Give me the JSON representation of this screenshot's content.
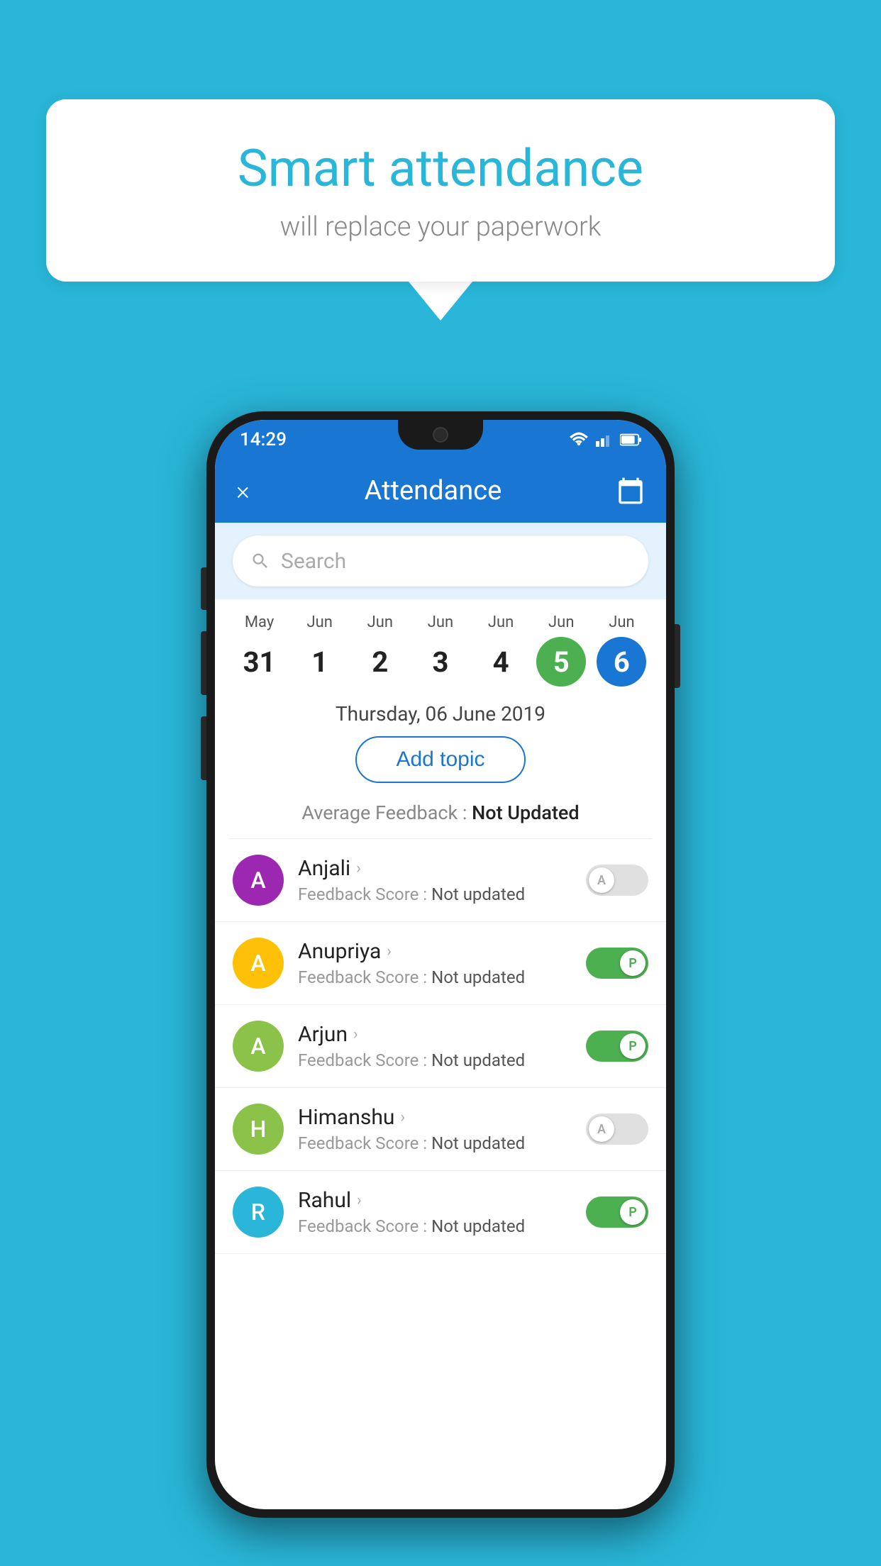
{
  "background_color": "#29b6d8",
  "speech_bubble": {
    "title": "Smart attendance",
    "subtitle": "will replace your paperwork"
  },
  "status_bar": {
    "time": "14:29",
    "wifi_icon": "wifi",
    "signal_icon": "signal",
    "battery_icon": "battery"
  },
  "header": {
    "title": "Attendance",
    "close_label": "×",
    "calendar_icon": "calendar"
  },
  "search": {
    "placeholder": "Search"
  },
  "calendar": {
    "days": [
      {
        "month": "May",
        "date": "31",
        "state": "normal"
      },
      {
        "month": "Jun",
        "date": "1",
        "state": "normal"
      },
      {
        "month": "Jun",
        "date": "2",
        "state": "normal"
      },
      {
        "month": "Jun",
        "date": "3",
        "state": "normal"
      },
      {
        "month": "Jun",
        "date": "4",
        "state": "normal"
      },
      {
        "month": "Jun",
        "date": "5",
        "state": "today"
      },
      {
        "month": "Jun",
        "date": "6",
        "state": "selected"
      }
    ]
  },
  "selected_date_label": "Thursday, 06 June 2019",
  "add_topic_label": "Add topic",
  "average_feedback": {
    "label": "Average Feedback : ",
    "value": "Not Updated"
  },
  "students": [
    {
      "name": "Anjali",
      "avatar_letter": "A",
      "avatar_color": "#9c27b0",
      "feedback_label": "Feedback Score : ",
      "feedback_value": "Not updated",
      "attendance": "A",
      "toggle_state": "off"
    },
    {
      "name": "Anupriya",
      "avatar_letter": "A",
      "avatar_color": "#ffc107",
      "feedback_label": "Feedback Score : ",
      "feedback_value": "Not updated",
      "attendance": "P",
      "toggle_state": "on"
    },
    {
      "name": "Arjun",
      "avatar_letter": "A",
      "avatar_color": "#8bc34a",
      "feedback_label": "Feedback Score : ",
      "feedback_value": "Not updated",
      "attendance": "P",
      "toggle_state": "on"
    },
    {
      "name": "Himanshu",
      "avatar_letter": "H",
      "avatar_color": "#8bc34a",
      "feedback_label": "Feedback Score : ",
      "feedback_value": "Not updated",
      "attendance": "A",
      "toggle_state": "off"
    },
    {
      "name": "Rahul",
      "avatar_letter": "R",
      "avatar_color": "#29b6d8",
      "feedback_label": "Feedback Score : ",
      "feedback_value": "Not updated",
      "attendance": "P",
      "toggle_state": "on"
    }
  ]
}
